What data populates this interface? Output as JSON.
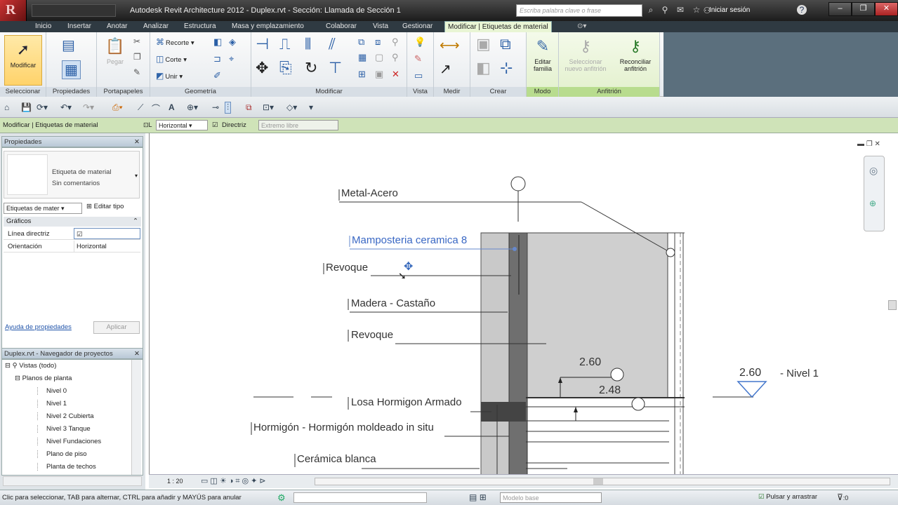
{
  "window": {
    "title": "Autodesk Revit Architecture 2012 -    Duplex.rvt - Sección: Llamada de Sección 1",
    "search_placeholder": "Escriba palabra clave o frase",
    "login_label": "Iniciar sesión"
  },
  "tabs": [
    "Inicio",
    "Insertar",
    "Anotar",
    "Analizar",
    "Estructura",
    "Masa y emplazamiento",
    "Colaborar",
    "Vista",
    "Gestionar",
    "Modificar | Etiquetas de material"
  ],
  "ribbon": {
    "modify_label": "Modificar",
    "panels": [
      "Seleccionar",
      "Propiedades",
      "Portapapeles",
      "Geometría",
      "Modificar",
      "Vista",
      "Medir",
      "Crear",
      "Modo",
      "Anfitrión"
    ],
    "paste_label": "Pegar",
    "geometry": {
      "cut_label": "Recorte",
      "cope_label": "Corte",
      "join_label": "Unir"
    },
    "mode": {
      "edit_family_label": "Editar familia"
    },
    "host": {
      "select_host_label": "Seleccionar nuevo anfitrión",
      "reconcile_label": "Reconciliar anfitrión"
    }
  },
  "options_bar": {
    "context": "Modificar | Etiquetas de material",
    "orientation_value": "Horizontal",
    "leader_label": "Directriz",
    "leader_end_value": "Extremo libre"
  },
  "properties": {
    "title": "Propiedades",
    "type_name": "Etiqueta de material",
    "type_subname": "Sin comentarios",
    "selector_value": "Etiquetas de mater",
    "edit_type_label": "Editar tipo",
    "group": "Gráficos",
    "rows": [
      {
        "key": "Línea directriz",
        "value": "☑"
      },
      {
        "key": "Orientación",
        "value": "Horizontal"
      }
    ],
    "help_link": "Ayuda de propiedades",
    "apply_label": "Aplicar"
  },
  "browser": {
    "title": "Duplex.rvt - Navegador de proyectos",
    "items": [
      "Vistas (todo)",
      "Planos de planta",
      "Nivel 0",
      "Nivel 1",
      "Nivel 2 Cubierta",
      "Nivel 3 Tanque",
      "Nivel Fundaciones",
      "Plano de piso",
      "Planta de techos"
    ]
  },
  "drawing": {
    "tags": [
      "Metal-Acero",
      "Mamposteria ceramica 8",
      "Revoque",
      "Madera - Castaño",
      "Revoque",
      "Losa Hormigon Armado",
      "Hormigón - Hormigón moldeado in situ",
      "Cerámica blanca"
    ],
    "dim_1": "2.60",
    "dim_2": "2.48",
    "level_value": "2.60",
    "level_name": "- Nivel 1"
  },
  "view_control": {
    "scale": "1 : 20"
  },
  "status": {
    "message": "Clic para seleccionar, TAB para alternar, CTRL para añadir y MAYÚS para anular",
    "model_value": "Modelo base",
    "press_drag_label": "Pulsar y arrastrar",
    "filter_count": ":0"
  }
}
